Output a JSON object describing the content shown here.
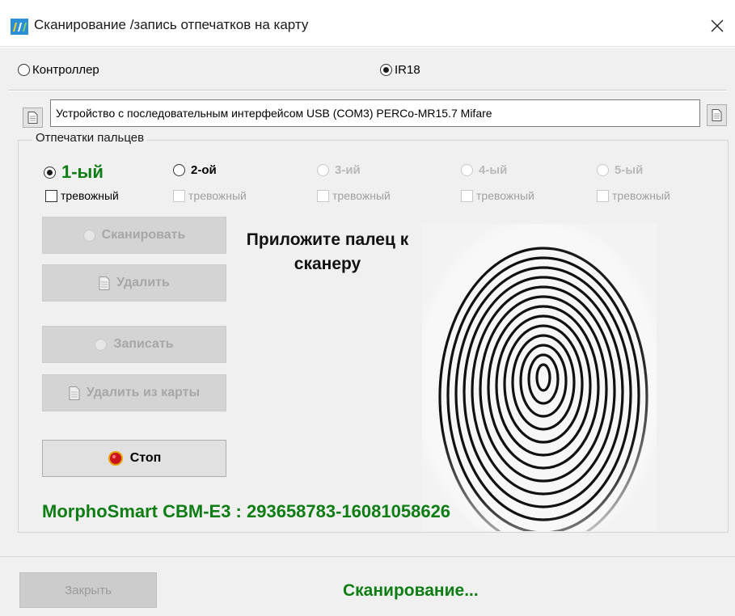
{
  "window": {
    "title": "Сканирование /запись отпечатков на карту"
  },
  "mode": {
    "controller_label": "Контроллер",
    "ir_label": "IR18",
    "selected": "IR18"
  },
  "device": {
    "value": "Устройство с последовательным интерфейсом USB (COM3) PERCo-MR15.7 Mifare"
  },
  "fingers": {
    "legend": "Отпечатки пальцев",
    "items": [
      {
        "label": "1-ый",
        "selected": true,
        "enabled": true,
        "alarm_label": "тревожный",
        "alarm_enabled": true
      },
      {
        "label": "2-ой",
        "selected": false,
        "enabled": true,
        "alarm_label": "тревожный",
        "alarm_enabled": false
      },
      {
        "label": "3-ий",
        "selected": false,
        "enabled": false,
        "alarm_label": "тревожный",
        "alarm_enabled": false
      },
      {
        "label": "4-ый",
        "selected": false,
        "enabled": false,
        "alarm_label": "тревожный",
        "alarm_enabled": false
      },
      {
        "label": "5-ый",
        "selected": false,
        "enabled": false,
        "alarm_label": "тревожный",
        "alarm_enabled": false
      }
    ]
  },
  "actions": {
    "scan_label": "Сканировать",
    "delete_label": "Удалить",
    "write_label": "Записать",
    "delete_card_label": "Удалить из карты",
    "stop_label": "Стоп"
  },
  "prompt": {
    "text": "Приложите палец к сканеру"
  },
  "scanner": {
    "device_info": "MorphoSmart CBM-E3 : 293658783-16081058626"
  },
  "footer": {
    "close_label": "Закрыть",
    "status": "Сканирование..."
  },
  "colors": {
    "accent_green": "#0e7d14",
    "disabled_text": "#a7a7a7",
    "dialog_bg": "#f0f0f0"
  },
  "icons": {
    "app": "perco-app-icon",
    "close": "close-icon",
    "document": "document-icon",
    "radio": "radio-circle-icon",
    "stop": "stop-icon"
  }
}
